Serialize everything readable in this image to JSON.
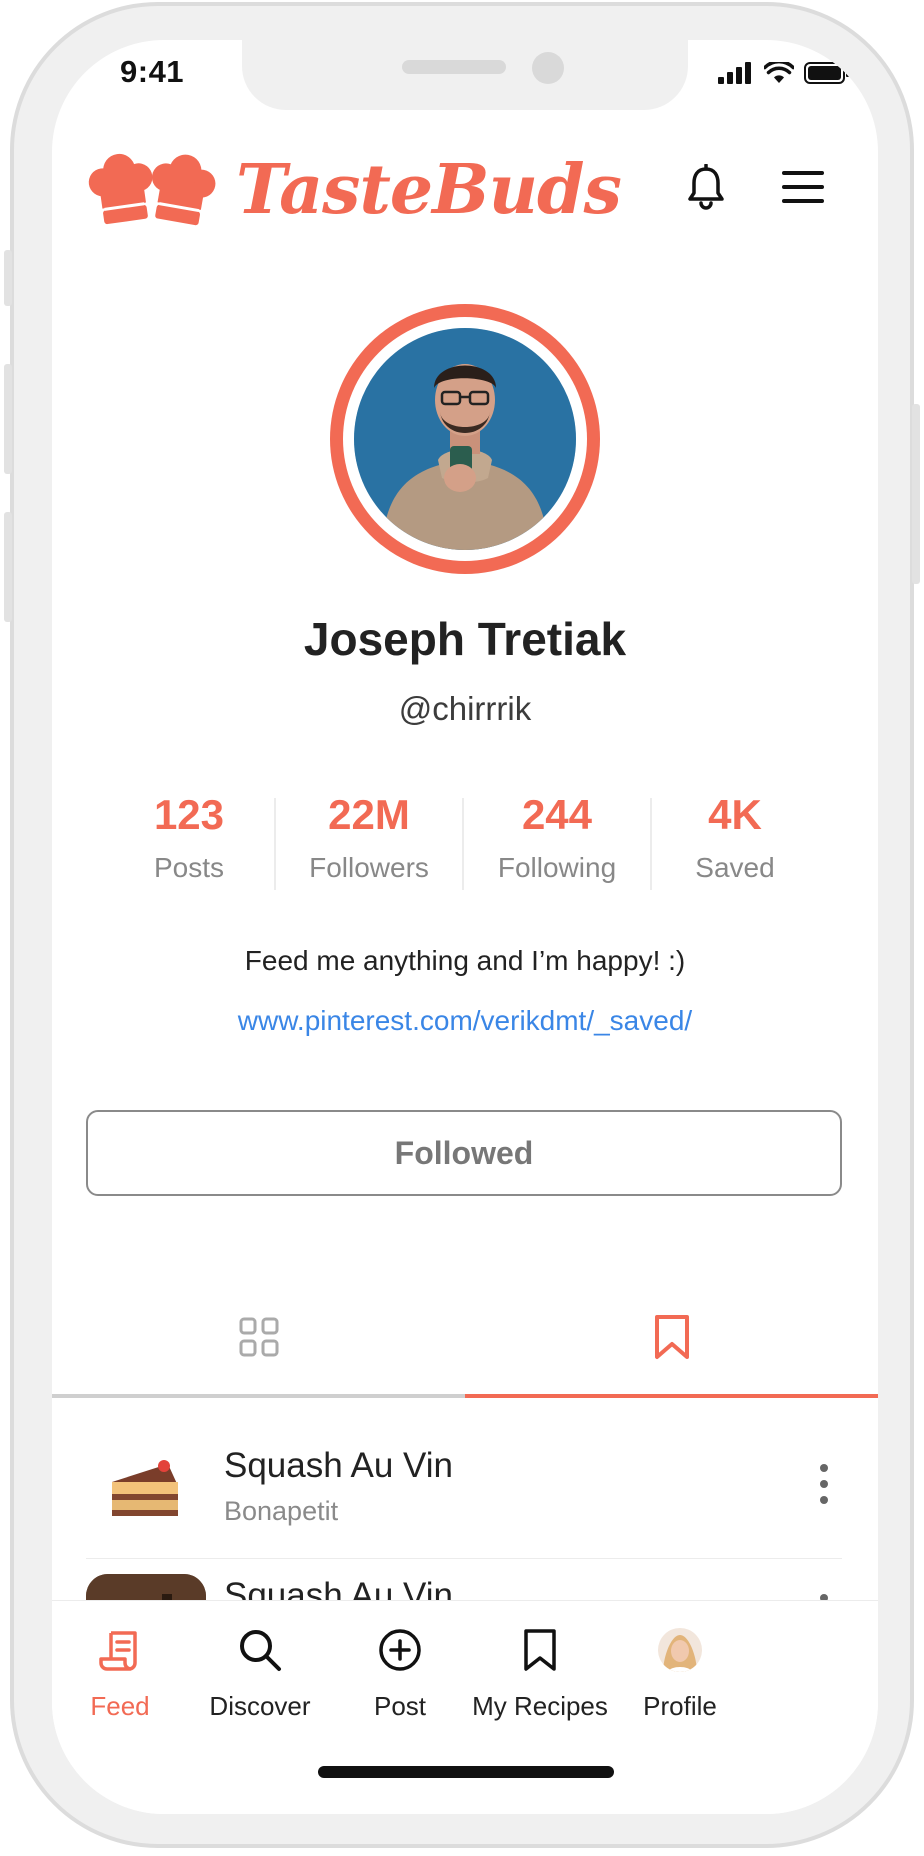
{
  "status_bar": {
    "time": "9:41"
  },
  "brand": {
    "name": "TasteBuds",
    "accent": "#F26A54"
  },
  "profile": {
    "name": "Joseph Tretiak",
    "handle": "@chirrrik",
    "bio": "Feed me anything and I’m happy! :)",
    "link": "www.pinterest.com/verikdmt/_saved/",
    "follow_label": "Followed"
  },
  "stats": [
    {
      "value": "123",
      "label": "Posts"
    },
    {
      "value": "22M",
      "label": "Followers"
    },
    {
      "value": "244",
      "label": "Following"
    },
    {
      "value": "4K",
      "label": "Saved"
    }
  ],
  "tabs": [
    {
      "icon": "grid-icon",
      "active": false
    },
    {
      "icon": "bookmark-icon",
      "active": true
    }
  ],
  "saved_items": [
    {
      "title": "Squash Au Vin",
      "source": "Bonapetit",
      "icon": "cake-icon"
    },
    {
      "title": "Squash Au Vin",
      "source": "",
      "icon": "food-photo"
    }
  ],
  "bottom_nav": [
    {
      "label": "Feed",
      "icon": "recipe-book-icon",
      "active": true
    },
    {
      "label": "Discover",
      "icon": "search-icon",
      "active": false
    },
    {
      "label": "Post",
      "icon": "plus-circle-icon",
      "active": false
    },
    {
      "label": "My Recipes",
      "icon": "bookmark-icon",
      "active": false
    },
    {
      "label": "Profile",
      "icon": "avatar",
      "active": false
    }
  ]
}
